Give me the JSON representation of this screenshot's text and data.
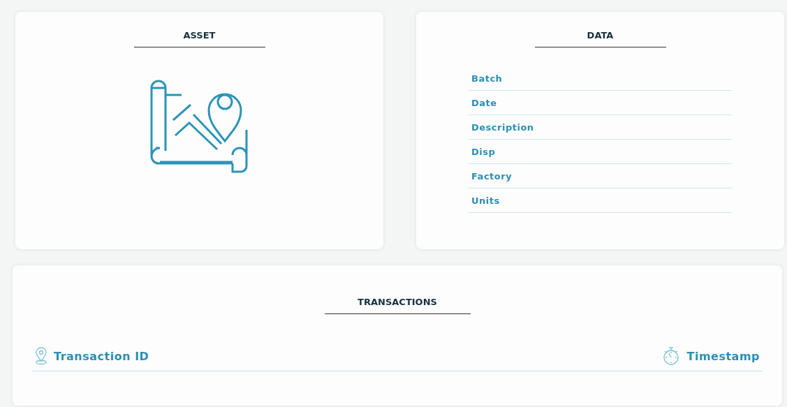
{
  "asset": {
    "title": "ASSET"
  },
  "data": {
    "title": "DATA",
    "fields": [
      "Batch",
      "Date",
      "Description",
      "Disp",
      "Factory",
      "Units"
    ]
  },
  "transactions": {
    "title": "TRANSACTIONS",
    "columns": [
      {
        "kind": "pin",
        "label": "Transaction ID"
      },
      {
        "kind": "stopwatch",
        "label": "Timestamp"
      }
    ]
  }
}
